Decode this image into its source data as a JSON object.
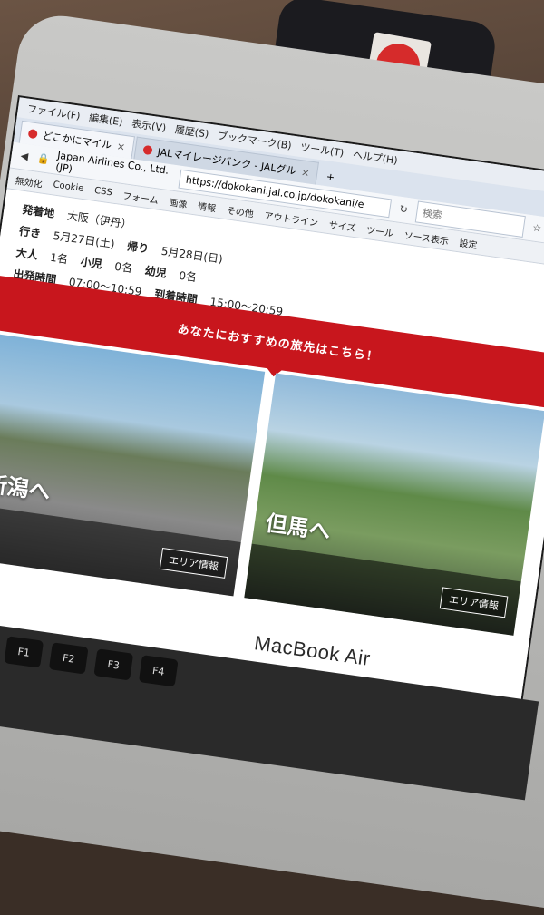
{
  "device_brand": "MacBook Air",
  "browser": {
    "menu": [
      "ファイル(F)",
      "編集(E)",
      "表示(V)",
      "履歴(S)",
      "ブックマーク(B)",
      "ツール(T)",
      "ヘルプ(H)"
    ],
    "tabs": [
      {
        "label": "どこかにマイル"
      },
      {
        "label": "JALマイレージバンク - JALグル"
      }
    ],
    "identity": "Japan Airlines Co., Ltd. (JP)",
    "url": "https://dokokani.jal.co.jp/dokokani/e",
    "search_placeholder": "検索",
    "dev_toolbar": [
      "無効化",
      "Cookie",
      "CSS",
      "フォーム",
      "画像",
      "情報",
      "その他",
      "アウトライン",
      "サイズ",
      "ツール",
      "ソース表示",
      "設定"
    ]
  },
  "itinerary": {
    "origin_label": "発着地",
    "origin_value": "大阪（伊丹）",
    "outbound_label": "行き",
    "outbound_date": "5月27日(土)",
    "adult_label": "大人",
    "adult_count": "1名",
    "depart_time_label": "出発時間",
    "depart_time": "07:00〜10:59",
    "child_label": "小児",
    "child_count": "0名",
    "infant_label": "幼児",
    "infant_count": "0名",
    "return_label": "帰り",
    "return_date": "5月28日(日)",
    "arrival_time_label": "到着時間",
    "arrival_time": "15:00〜20:59"
  },
  "banner_text": "あなたにおすすめの旅先はこちら！",
  "destinations": [
    {
      "title": "新潟へ",
      "area_button": "エリア情報"
    },
    {
      "title": "但馬へ",
      "area_button": "エリア情報"
    }
  ],
  "keyboard": {
    "f1": "F1",
    "f2": "F2",
    "f3": "F3",
    "f4": "F4"
  }
}
